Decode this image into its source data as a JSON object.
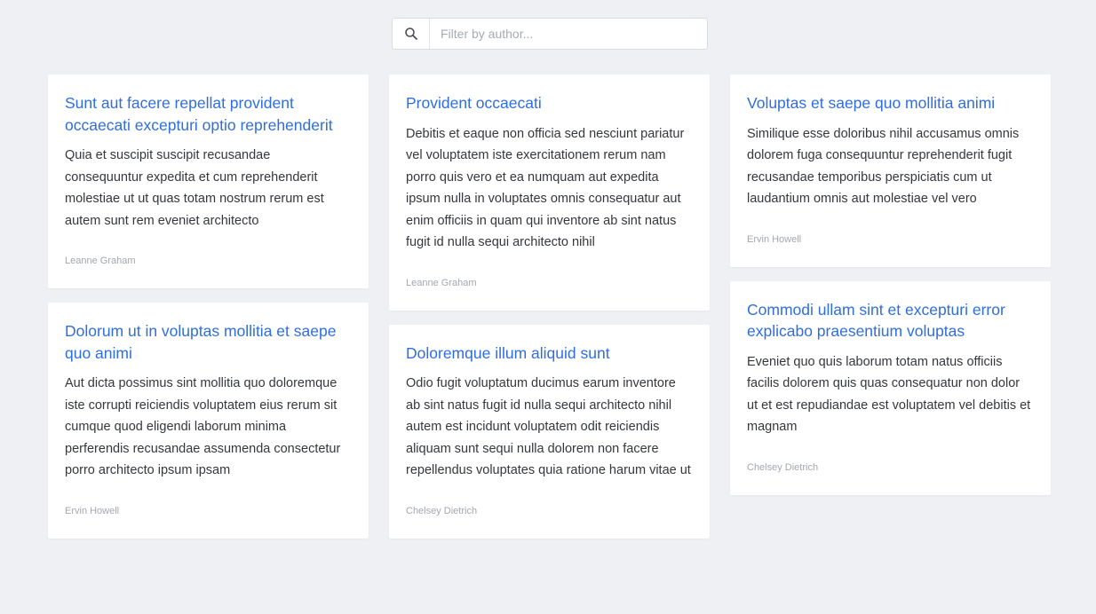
{
  "search": {
    "placeholder": "Filter by author...",
    "value": "",
    "icon": "search-icon"
  },
  "colors": {
    "background": "#eef0f4",
    "card": "#ffffff",
    "title": "#2f6ee0",
    "body": "#34373c",
    "author": "#a3a7ae"
  },
  "posts": [
    {
      "title": "Sunt aut facere repellat provident occaecati excepturi optio reprehenderit",
      "body": "Quia et suscipit suscipit recusandae consequuntur expedita et cum reprehenderit molestiae ut ut quas totam nostrum rerum est autem sunt rem eveniet architecto",
      "author": "Leanne Graham"
    },
    {
      "title": "Provident occaecati",
      "body": "Debitis et eaque non officia sed nesciunt pariatur vel voluptatem iste exercitationem rerum nam porro quis vero et ea numquam aut expedita ipsum nulla in voluptates omnis consequatur aut enim officiis in quam qui inventore ab sint natus fugit id nulla sequi architecto nihil",
      "author": "Leanne Graham"
    },
    {
      "title": "Voluptas et saepe quo mollitia animi",
      "body": "Similique esse doloribus nihil accusamus omnis dolorem fuga consequuntur reprehenderit fugit recusandae temporibus perspiciatis cum ut laudantium omnis aut molestiae vel vero",
      "author": "Ervin Howell"
    },
    {
      "title": "Dolorum ut in voluptas mollitia et saepe quo animi",
      "body": "Aut dicta possimus sint mollitia quo doloremque iste corrupti reiciendis voluptatem eius rerum sit cumque quod eligendi laborum minima perferendis recusandae assumenda consectetur porro architecto ipsum ipsam",
      "author": "Ervin Howell"
    },
    {
      "title": "Doloremque illum aliquid sunt",
      "body": "Odio fugit voluptatum ducimus earum inventore ab sint natus fugit id nulla sequi architecto nihil autem est incidunt voluptatem odit reiciendis aliquam sunt sequi nulla dolorem non facere repellendus voluptates quia ratione harum vitae ut",
      "author": "Chelsey Dietrich"
    },
    {
      "title": "Commodi ullam sint et excepturi error explicabo praesentium voluptas",
      "body": "Eveniet quo quis laborum totam natus officiis facilis dolorem quis quas consequatur non dolor ut et est repudiandae est voluptatem vel debitis et magnam",
      "author": "Chelsey Dietrich"
    }
  ]
}
